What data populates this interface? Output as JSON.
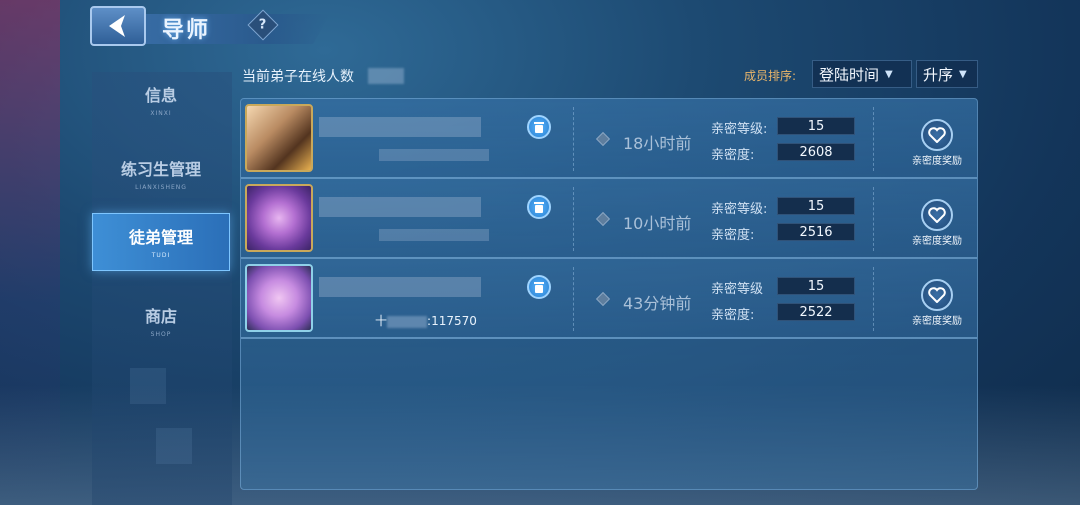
{
  "header": {
    "title": "导师",
    "help": "?"
  },
  "sidebar": {
    "items": [
      {
        "zh": "信息",
        "en": "XINXI"
      },
      {
        "zh": "练习生管理",
        "en": "LIANXISHENG"
      },
      {
        "zh": "徒弟管理",
        "en": "TUDI"
      },
      {
        "zh": "商店",
        "en": "SHOP"
      }
    ]
  },
  "main": {
    "online_label": "当前弟子在线人数",
    "sort_label": "成员排序:",
    "sort_field": "登陆时间",
    "sort_order": "升序",
    "rows": [
      {
        "time": "18小时前",
        "intimacy_level_label": "亲密等级:",
        "intimacy_level": "15",
        "intimacy_label": "亲密度:",
        "intimacy": "2608",
        "reward_label": "亲密度奖励"
      },
      {
        "time": "10小时前",
        "intimacy_level_label": "亲密等级:",
        "intimacy_level": "15",
        "intimacy_label": "亲密度:",
        "intimacy": "2516",
        "reward_label": "亲密度奖励"
      },
      {
        "time": "43分钟前",
        "intimacy_level_label": "亲密等级",
        "intimacy_level": "15",
        "intimacy_label": "亲密度:",
        "intimacy": "2522",
        "reward_label": "亲密度奖励",
        "score_text": "十",
        "score_value": "117570"
      }
    ]
  },
  "colors": {
    "accent": "#3e8fd6",
    "sort_label": "#e8b56a",
    "value_bg": "#142e4d"
  }
}
